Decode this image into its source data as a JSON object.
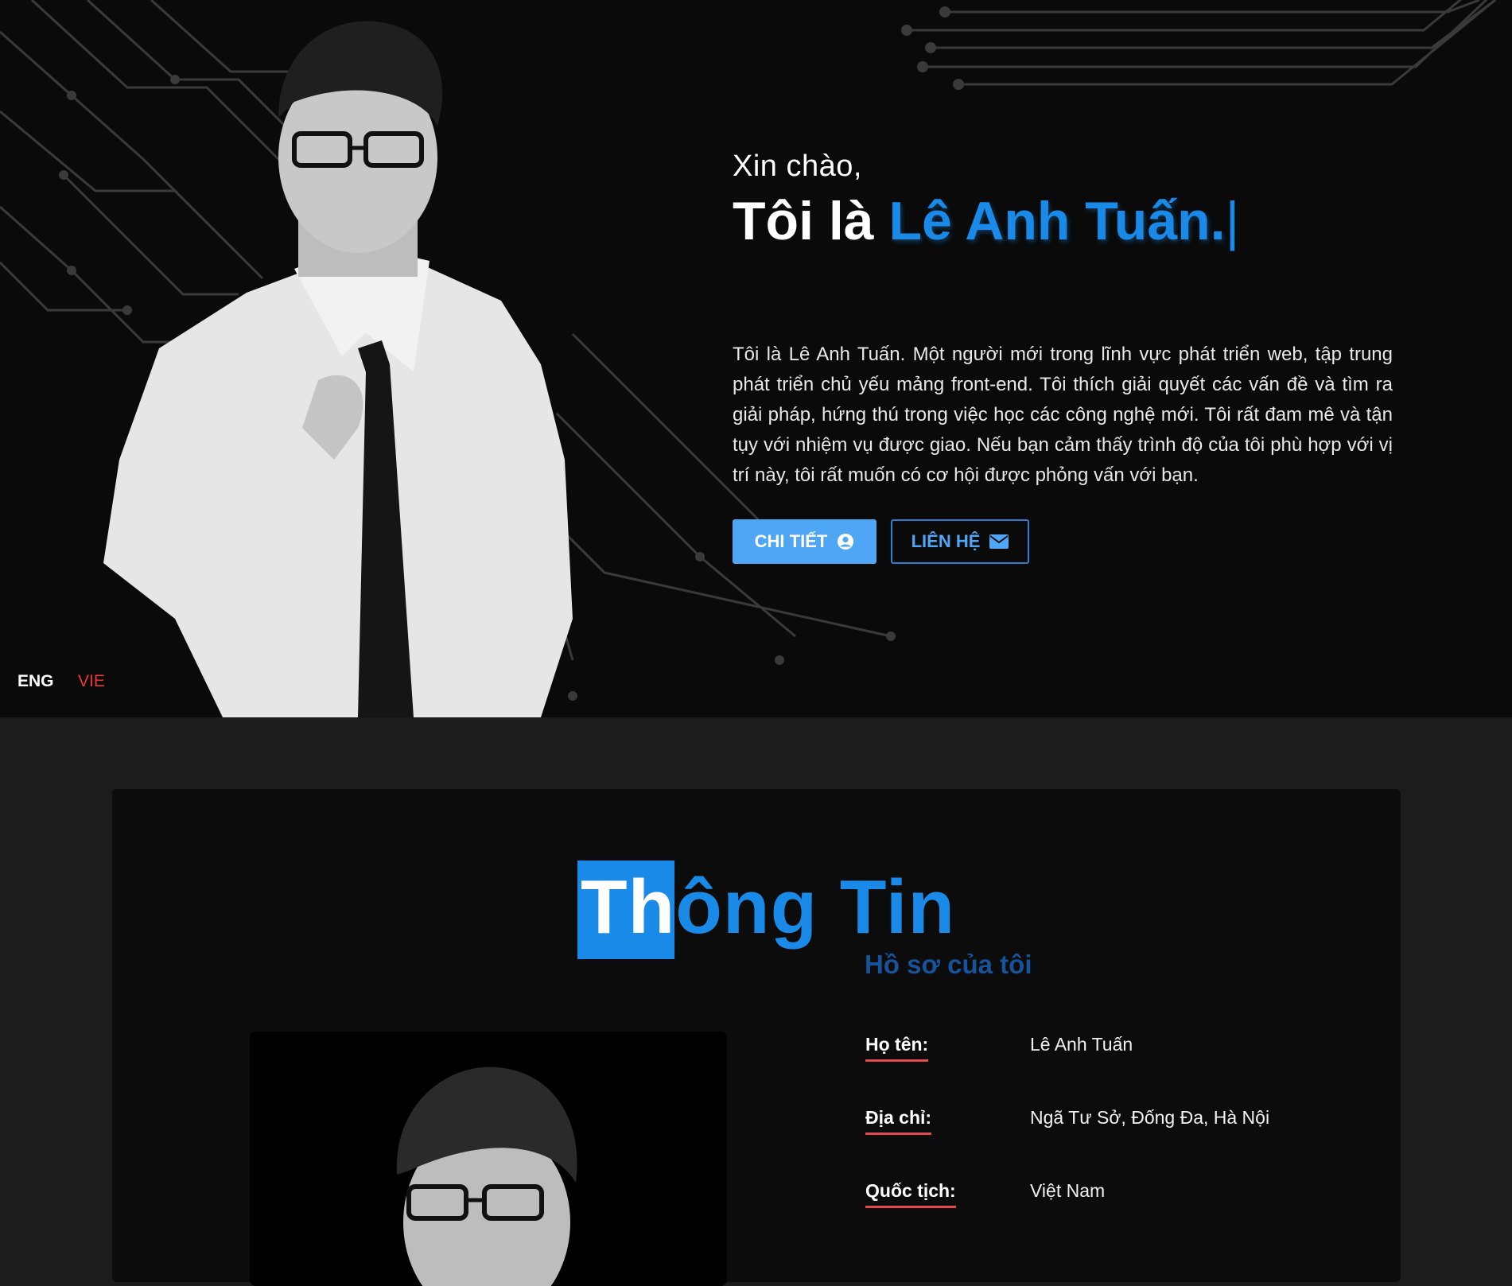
{
  "hero": {
    "greeting": "Xin chào,",
    "intro_prefix": "Tôi là",
    "name": "Lê Anh Tuấn.",
    "caret": "|",
    "bio": "Tôi là Lê Anh Tuấn. Một người mới trong lĩnh vực phát triển web, tập trung phát triển chủ yếu mảng front-end. Tôi thích giải quyết các vấn đề và tìm ra giải pháp, hứng thú trong việc học các công nghệ mới. Tôi rất đam mê và tận tụy với nhiệm vụ được giao. Nếu bạn cảm thấy trình độ của tôi phù hợp với vị trí này, tôi rất muốn có cơ hội được phỏng vấn với bạn.",
    "detail_button": "CHI TIẾT",
    "contact_button": "LIÊN HỆ",
    "detail_icon": "user-circle-icon",
    "contact_icon": "envelope-icon"
  },
  "language": {
    "eng": "ENG",
    "vie": "VIE",
    "active": "VIE"
  },
  "about": {
    "title_highlight": "Th",
    "title_rest": "ông Tin",
    "subtitle": "Hồ sơ của tôi",
    "fields": [
      {
        "label": "Họ tên:",
        "value": "Lê Anh Tuấn"
      },
      {
        "label": "Địa chỉ:",
        "value": "Ngã Tư Sở, Đống Đa, Hà Nội"
      },
      {
        "label": "Quốc tịch:",
        "value": "Việt Nam"
      }
    ]
  },
  "colors": {
    "accent": "#1a8ae8",
    "button": "#4ea6f5",
    "underline": "#e5484d",
    "lang_active": "#e53935",
    "hero_bg": "#0a0a0a",
    "section_bg": "#1c1c1c"
  }
}
